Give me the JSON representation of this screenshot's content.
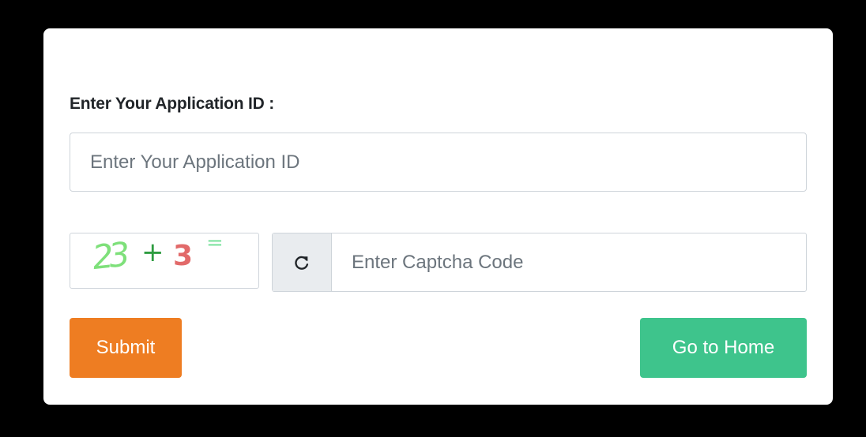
{
  "form": {
    "application_id_label": "Enter Your Application ID :",
    "application_id_placeholder": "Enter Your Application ID",
    "application_id_value": "",
    "captcha": {
      "first": "23",
      "operator": "+",
      "second": "3",
      "equals": "=",
      "placeholder": "Enter Captcha Code",
      "value": ""
    },
    "submit_label": "Submit",
    "home_label": "Go to Home"
  },
  "icons": {
    "refresh": "refresh-icon"
  },
  "colors": {
    "submit": "#ee7d22",
    "home": "#3ec48c",
    "background": "#000000",
    "card": "#ffffff"
  }
}
